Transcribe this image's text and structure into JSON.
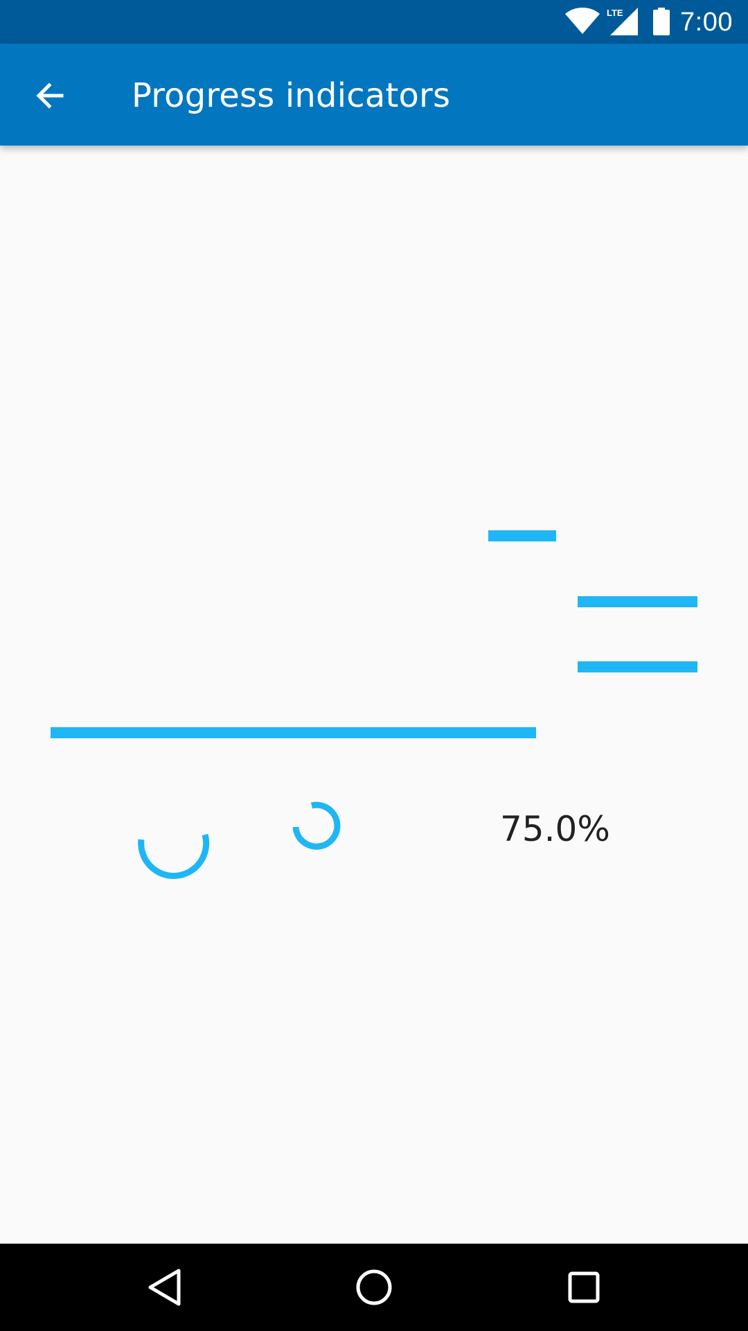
{
  "status_bar": {
    "time": "7:00",
    "network_label": "LTE",
    "icons": [
      "wifi-icon",
      "lte-signal-icon",
      "battery-icon"
    ],
    "background": "#005a99"
  },
  "app_bar": {
    "title": "Progress indicators",
    "back_icon": "arrow-back-icon",
    "background": "#0277c0"
  },
  "progress": {
    "percent_text": "75.0%",
    "accent_color": "#1eb6f5"
  },
  "nav_bar": {
    "icons": [
      "nav-back-icon",
      "nav-home-icon",
      "nav-recents-icon"
    ]
  }
}
